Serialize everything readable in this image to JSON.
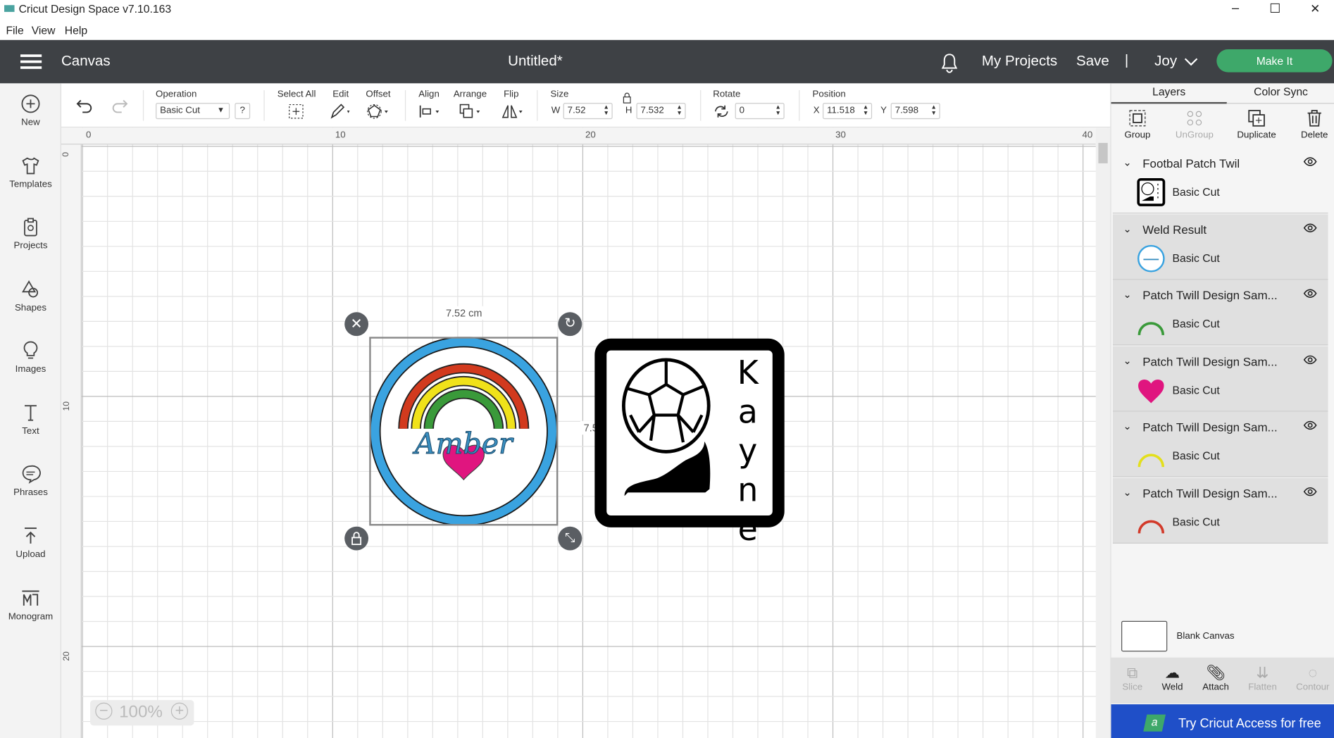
{
  "window": {
    "title": "Cricut Design Space  v7.10.163",
    "minimize": "–",
    "maximize": "☐",
    "close": "✕"
  },
  "menu": [
    "File",
    "View",
    "Help"
  ],
  "header": {
    "section": "Canvas",
    "doc_title": "Untitled*",
    "my_projects": "My Projects",
    "save": "Save",
    "divider": "|",
    "user": "Joy",
    "make_it": "Make It",
    "accent": "#3ea86a"
  },
  "sidebar": [
    {
      "label": "New",
      "icon": "plus-circle-icon"
    },
    {
      "label": "Templates",
      "icon": "shirt-icon"
    },
    {
      "label": "Projects",
      "icon": "clipboard-icon"
    },
    {
      "label": "Shapes",
      "icon": "shapes-icon"
    },
    {
      "label": "Images",
      "icon": "lightbulb-icon"
    },
    {
      "label": "Text",
      "icon": "text-icon"
    },
    {
      "label": "Phrases",
      "icon": "speech-bubble-icon"
    },
    {
      "label": "Upload",
      "icon": "upload-icon"
    },
    {
      "label": "Monogram",
      "icon": "monogram-icon"
    }
  ],
  "toolbar": {
    "operation_label": "Operation",
    "operation_value": "Basic Cut",
    "help": "?",
    "select_all": "Select All",
    "edit": "Edit",
    "offset": "Offset",
    "align": "Align",
    "arrange": "Arrange",
    "flip": "Flip",
    "size": "Size",
    "w_label": "W",
    "w": "7.52",
    "h_label": "H",
    "h": "7.532",
    "rotate": "Rotate",
    "rotate_value": "0",
    "position": "Position",
    "x_label": "X",
    "x": "11.518",
    "y_label": "Y",
    "y": "7.598"
  },
  "rulers": {
    "top": [
      "0",
      "10",
      "20",
      "30",
      "40"
    ],
    "left": [
      "0",
      "10",
      "20"
    ]
  },
  "canvas": {
    "width_label": "7.52 cm",
    "height_label": "7.532 cm",
    "amber_text": "Amber",
    "kayne_text": "Kayne",
    "zoom": "100%",
    "zoom_out": "−",
    "zoom_in": "+"
  },
  "panel": {
    "tabs": [
      "Layers",
      "Color Sync"
    ],
    "actions": [
      "Group",
      "UnGroup",
      "Duplicate",
      "Delete"
    ],
    "layers": [
      {
        "name": "Footbal Patch Twil",
        "op": "Basic Cut",
        "thumb": "football-patch"
      },
      {
        "name": "Weld Result",
        "op": "Basic Cut",
        "thumb": "amber-circle"
      },
      {
        "name": "Patch Twill Design Sam...",
        "op": "Basic Cut",
        "thumb": "arc",
        "color": "#3a9a3a"
      },
      {
        "name": "Patch Twill Design Sam...",
        "op": "Basic Cut",
        "thumb": "heart",
        "color": "#e0157f"
      },
      {
        "name": "Patch Twill Design Sam...",
        "op": "Basic Cut",
        "thumb": "arc",
        "color": "#e3df1c"
      },
      {
        "name": "Patch Twill Design Sam...",
        "op": "Basic Cut",
        "thumb": "arc",
        "color": "#d23a2a"
      }
    ],
    "blank_canvas": "Blank Canvas",
    "tools": [
      "Slice",
      "Weld",
      "Attach",
      "Flatten",
      "Contour"
    ],
    "promo": "Try Cricut Access for free",
    "promo_color": "#1f4fc8"
  }
}
